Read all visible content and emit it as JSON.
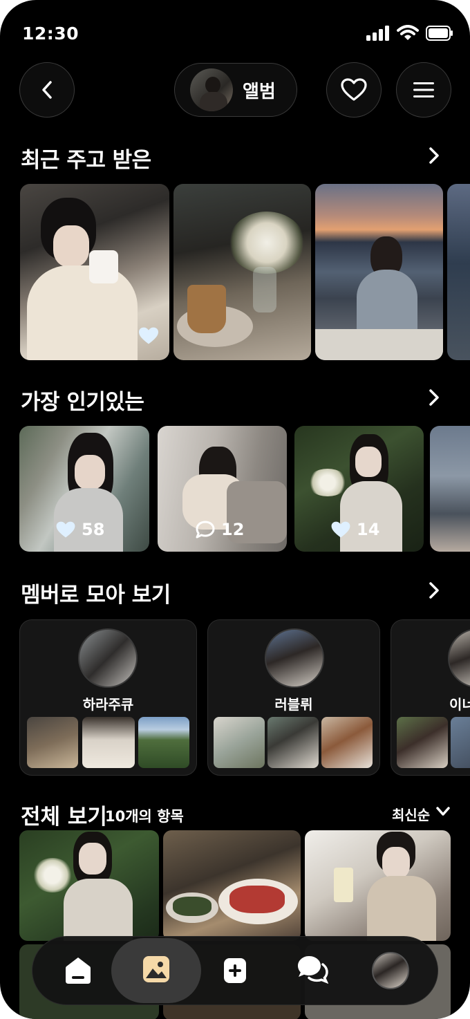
{
  "status_bar": {
    "time": "12:30"
  },
  "header": {
    "title": "앨범"
  },
  "sections": {
    "recent": {
      "title": "최근 주고 받은"
    },
    "popular": {
      "title": "가장 인기있는",
      "items": [
        {
          "count": "58",
          "icon": "heart-icon"
        },
        {
          "count": "12",
          "icon": "comment-icon"
        },
        {
          "count": "14",
          "icon": "heart-icon"
        }
      ]
    },
    "members": {
      "title": "멤버로 모아 보기",
      "items": [
        {
          "name": "하라주큐"
        },
        {
          "name": "러블뤼"
        },
        {
          "name": "이너"
        }
      ]
    },
    "all": {
      "title": "전체 보기",
      "count": "10개의 항목",
      "sort": "최신순"
    }
  },
  "bottom_nav": {
    "items": [
      "home-icon",
      "gallery-icon",
      "add-icon",
      "chat-icon",
      "profile-avatar"
    ],
    "active": "gallery-icon"
  },
  "colors": {
    "background": "#000000",
    "heart": "#dff0ff",
    "card_bg": "#161616"
  }
}
